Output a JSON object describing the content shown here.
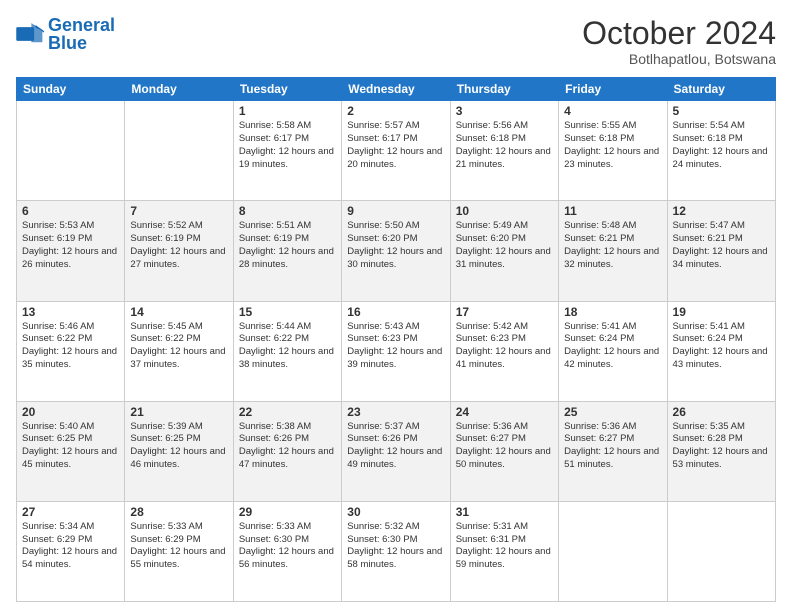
{
  "header": {
    "logo_general": "General",
    "logo_blue": "Blue",
    "month": "October 2024",
    "location": "Botlhapatlou, Botswana"
  },
  "weekdays": [
    "Sunday",
    "Monday",
    "Tuesday",
    "Wednesday",
    "Thursday",
    "Friday",
    "Saturday"
  ],
  "weeks": [
    [
      {
        "day": "",
        "info": ""
      },
      {
        "day": "",
        "info": ""
      },
      {
        "day": "1",
        "info": "Sunrise: 5:58 AM\nSunset: 6:17 PM\nDaylight: 12 hours and 19 minutes."
      },
      {
        "day": "2",
        "info": "Sunrise: 5:57 AM\nSunset: 6:17 PM\nDaylight: 12 hours and 20 minutes."
      },
      {
        "day": "3",
        "info": "Sunrise: 5:56 AM\nSunset: 6:18 PM\nDaylight: 12 hours and 21 minutes."
      },
      {
        "day": "4",
        "info": "Sunrise: 5:55 AM\nSunset: 6:18 PM\nDaylight: 12 hours and 23 minutes."
      },
      {
        "day": "5",
        "info": "Sunrise: 5:54 AM\nSunset: 6:18 PM\nDaylight: 12 hours and 24 minutes."
      }
    ],
    [
      {
        "day": "6",
        "info": "Sunrise: 5:53 AM\nSunset: 6:19 PM\nDaylight: 12 hours and 26 minutes."
      },
      {
        "day": "7",
        "info": "Sunrise: 5:52 AM\nSunset: 6:19 PM\nDaylight: 12 hours and 27 minutes."
      },
      {
        "day": "8",
        "info": "Sunrise: 5:51 AM\nSunset: 6:19 PM\nDaylight: 12 hours and 28 minutes."
      },
      {
        "day": "9",
        "info": "Sunrise: 5:50 AM\nSunset: 6:20 PM\nDaylight: 12 hours and 30 minutes."
      },
      {
        "day": "10",
        "info": "Sunrise: 5:49 AM\nSunset: 6:20 PM\nDaylight: 12 hours and 31 minutes."
      },
      {
        "day": "11",
        "info": "Sunrise: 5:48 AM\nSunset: 6:21 PM\nDaylight: 12 hours and 32 minutes."
      },
      {
        "day": "12",
        "info": "Sunrise: 5:47 AM\nSunset: 6:21 PM\nDaylight: 12 hours and 34 minutes."
      }
    ],
    [
      {
        "day": "13",
        "info": "Sunrise: 5:46 AM\nSunset: 6:22 PM\nDaylight: 12 hours and 35 minutes."
      },
      {
        "day": "14",
        "info": "Sunrise: 5:45 AM\nSunset: 6:22 PM\nDaylight: 12 hours and 37 minutes."
      },
      {
        "day": "15",
        "info": "Sunrise: 5:44 AM\nSunset: 6:22 PM\nDaylight: 12 hours and 38 minutes."
      },
      {
        "day": "16",
        "info": "Sunrise: 5:43 AM\nSunset: 6:23 PM\nDaylight: 12 hours and 39 minutes."
      },
      {
        "day": "17",
        "info": "Sunrise: 5:42 AM\nSunset: 6:23 PM\nDaylight: 12 hours and 41 minutes."
      },
      {
        "day": "18",
        "info": "Sunrise: 5:41 AM\nSunset: 6:24 PM\nDaylight: 12 hours and 42 minutes."
      },
      {
        "day": "19",
        "info": "Sunrise: 5:41 AM\nSunset: 6:24 PM\nDaylight: 12 hours and 43 minutes."
      }
    ],
    [
      {
        "day": "20",
        "info": "Sunrise: 5:40 AM\nSunset: 6:25 PM\nDaylight: 12 hours and 45 minutes."
      },
      {
        "day": "21",
        "info": "Sunrise: 5:39 AM\nSunset: 6:25 PM\nDaylight: 12 hours and 46 minutes."
      },
      {
        "day": "22",
        "info": "Sunrise: 5:38 AM\nSunset: 6:26 PM\nDaylight: 12 hours and 47 minutes."
      },
      {
        "day": "23",
        "info": "Sunrise: 5:37 AM\nSunset: 6:26 PM\nDaylight: 12 hours and 49 minutes."
      },
      {
        "day": "24",
        "info": "Sunrise: 5:36 AM\nSunset: 6:27 PM\nDaylight: 12 hours and 50 minutes."
      },
      {
        "day": "25",
        "info": "Sunrise: 5:36 AM\nSunset: 6:27 PM\nDaylight: 12 hours and 51 minutes."
      },
      {
        "day": "26",
        "info": "Sunrise: 5:35 AM\nSunset: 6:28 PM\nDaylight: 12 hours and 53 minutes."
      }
    ],
    [
      {
        "day": "27",
        "info": "Sunrise: 5:34 AM\nSunset: 6:29 PM\nDaylight: 12 hours and 54 minutes."
      },
      {
        "day": "28",
        "info": "Sunrise: 5:33 AM\nSunset: 6:29 PM\nDaylight: 12 hours and 55 minutes."
      },
      {
        "day": "29",
        "info": "Sunrise: 5:33 AM\nSunset: 6:30 PM\nDaylight: 12 hours and 56 minutes."
      },
      {
        "day": "30",
        "info": "Sunrise: 5:32 AM\nSunset: 6:30 PM\nDaylight: 12 hours and 58 minutes."
      },
      {
        "day": "31",
        "info": "Sunrise: 5:31 AM\nSunset: 6:31 PM\nDaylight: 12 hours and 59 minutes."
      },
      {
        "day": "",
        "info": ""
      },
      {
        "day": "",
        "info": ""
      }
    ]
  ]
}
